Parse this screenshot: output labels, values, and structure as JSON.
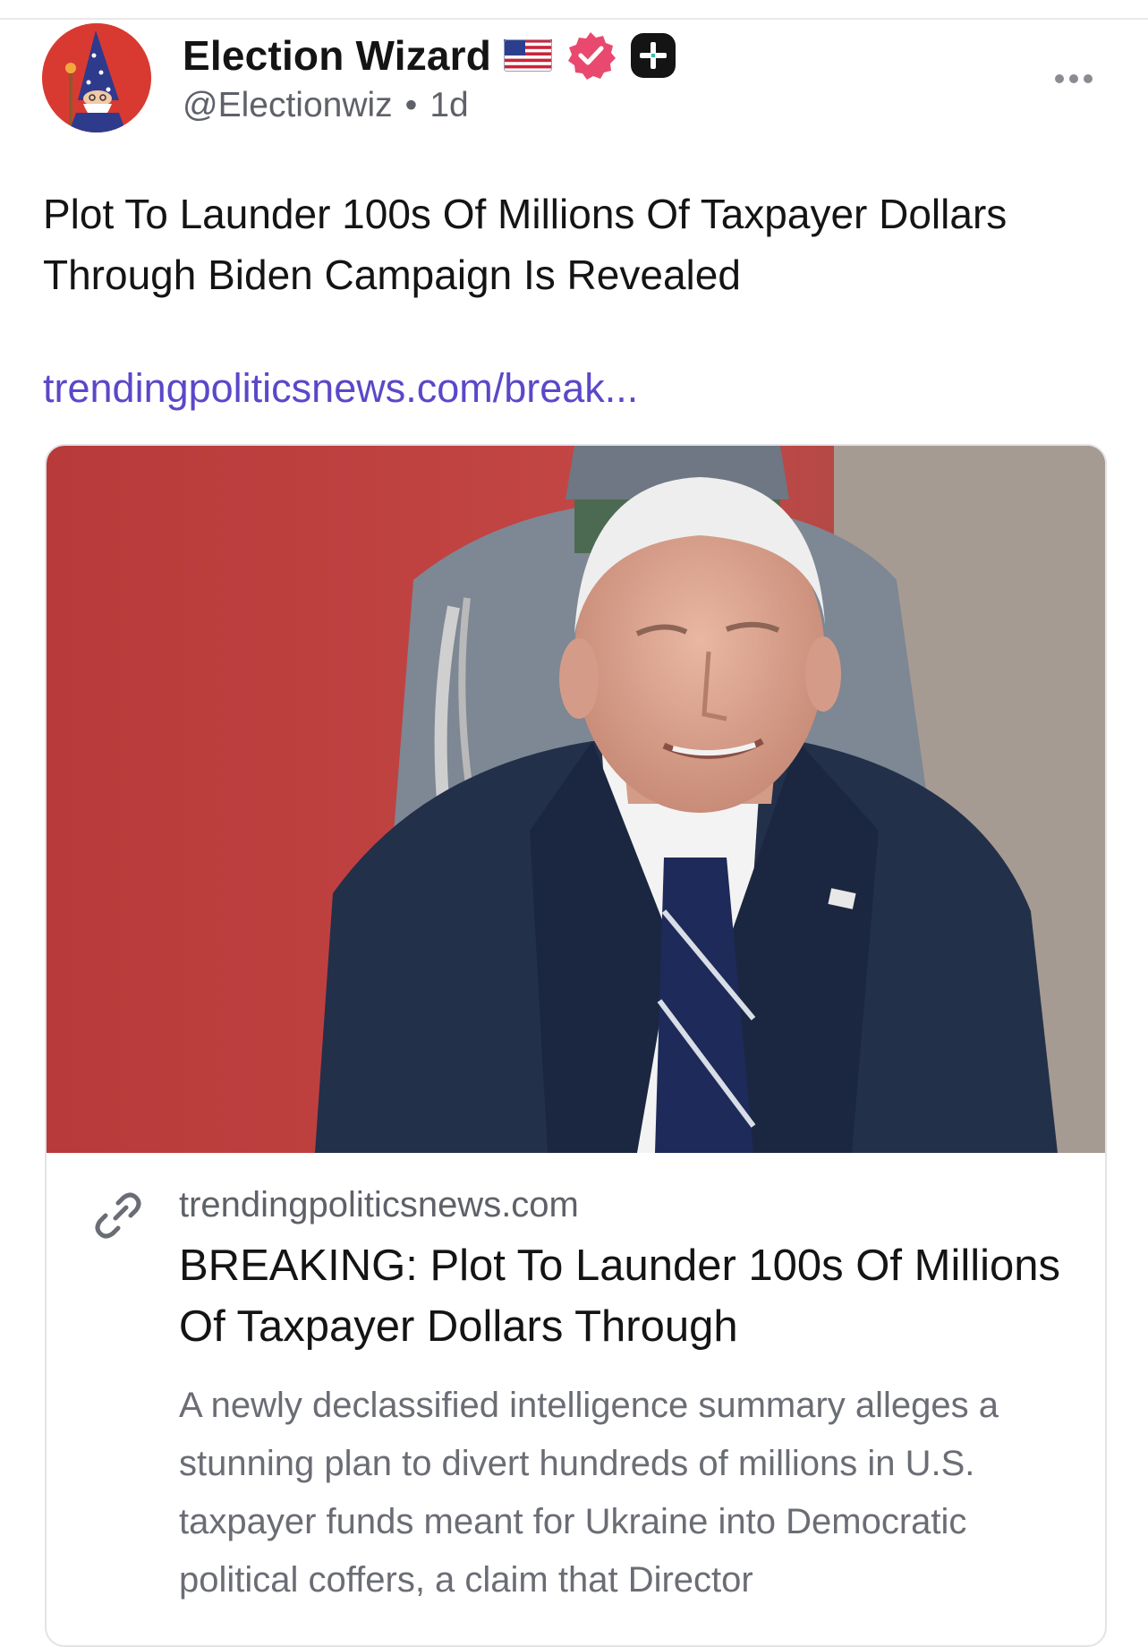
{
  "post": {
    "author": {
      "display_name": "Election Wizard",
      "handle": "@Electionwiz",
      "separator": "•",
      "age": "1d",
      "badges": [
        "us-flag-icon",
        "verified-icon",
        "plus-badge-icon"
      ]
    },
    "text": "Plot To Launder 100s Of Millions Of Taxpayer Dollars Through Biden Campaign Is Revealed",
    "link_text": "trendingpoliticsnews.com/break...",
    "more_icon": "more-horizontal-icon"
  },
  "link_card": {
    "image_icon": "article-photo",
    "link_icon": "link-chain-icon",
    "domain": "trendingpoliticsnews.com",
    "title": "BREAKING: Plot To Launder 100s Of Millions Of Taxpayer Dollars Through",
    "description": "A newly declassified intelligence summary alleges a stunning plan to divert hundreds of millions in U.S. taxpayer funds meant for Ukraine into Democratic political coffers, a claim that Director"
  },
  "colors": {
    "link": "#5a48c9",
    "verified_badge": "#e9496f",
    "avatar_bg": "#d83a32",
    "secondary_text": "#5f6169"
  }
}
